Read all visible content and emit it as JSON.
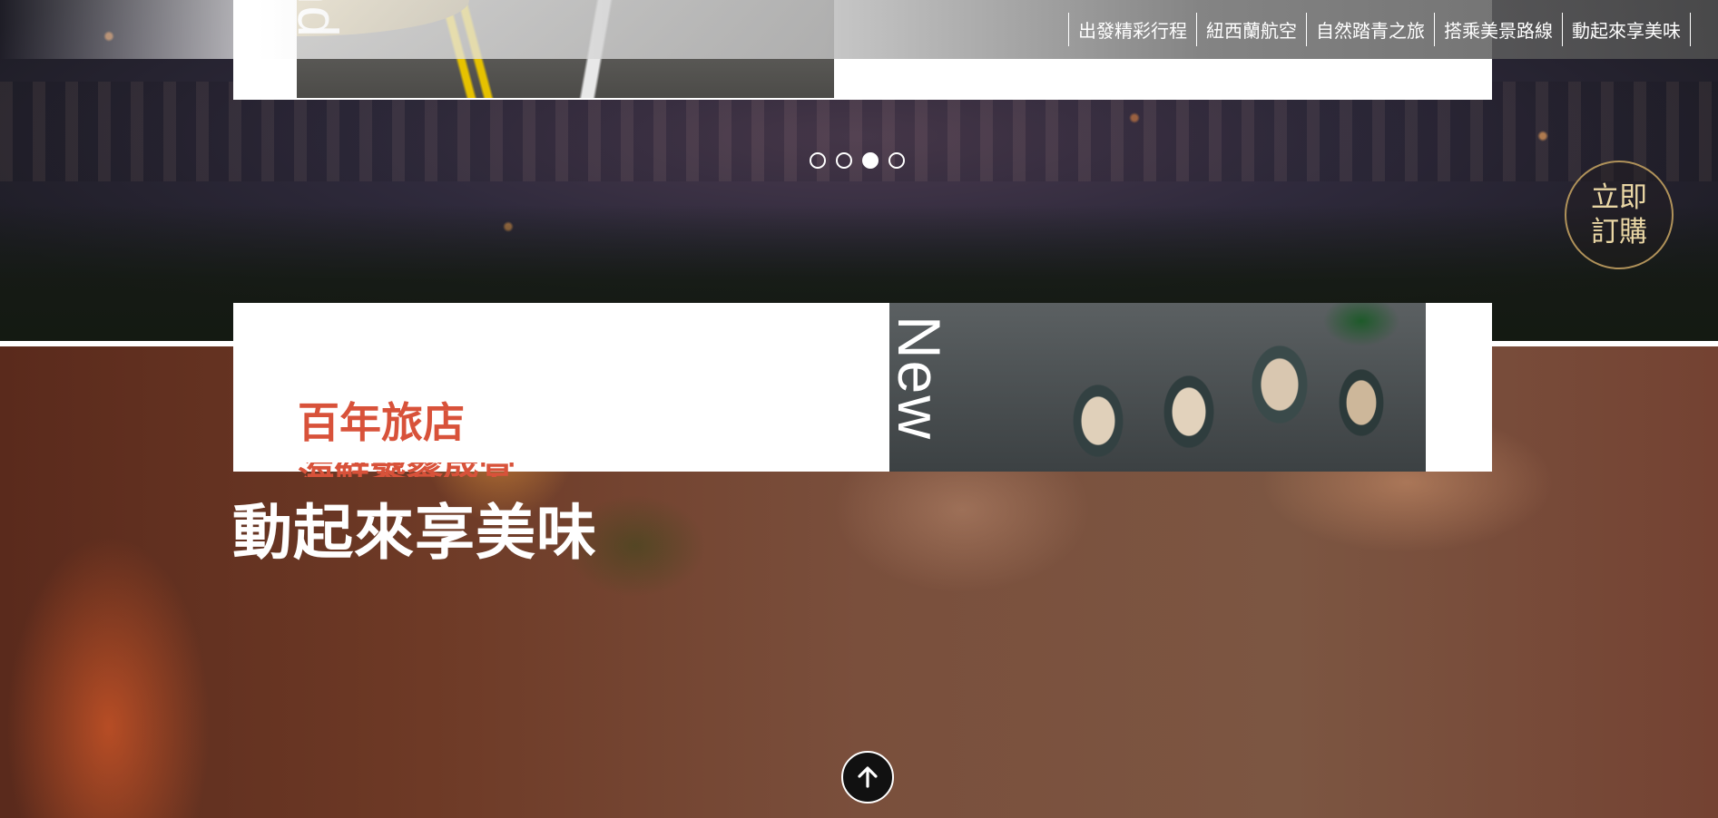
{
  "nav": {
    "items": [
      {
        "label": "出發精彩行程"
      },
      {
        "label": "紐西蘭航空"
      },
      {
        "label": "自然踏青之旅"
      },
      {
        "label": "搭乘美景路線"
      },
      {
        "label": "動起來享美味"
      }
    ]
  },
  "slider": {
    "vertical_word": "nd",
    "dot_count": 4,
    "active_dot": 3
  },
  "buy_button": {
    "label": "立即訂購"
  },
  "food_section": {
    "title": "動起來享美味",
    "vertical_word": "New",
    "hotel_title": "百年旅店",
    "hotel_subtitle": "海鮮饕餮盛宴"
  },
  "back_to_top": {
    "icon": "arrow-up-icon"
  },
  "colors": {
    "accent_red": "#d8523a",
    "gold": "#b0925a",
    "white": "#ffffff"
  }
}
